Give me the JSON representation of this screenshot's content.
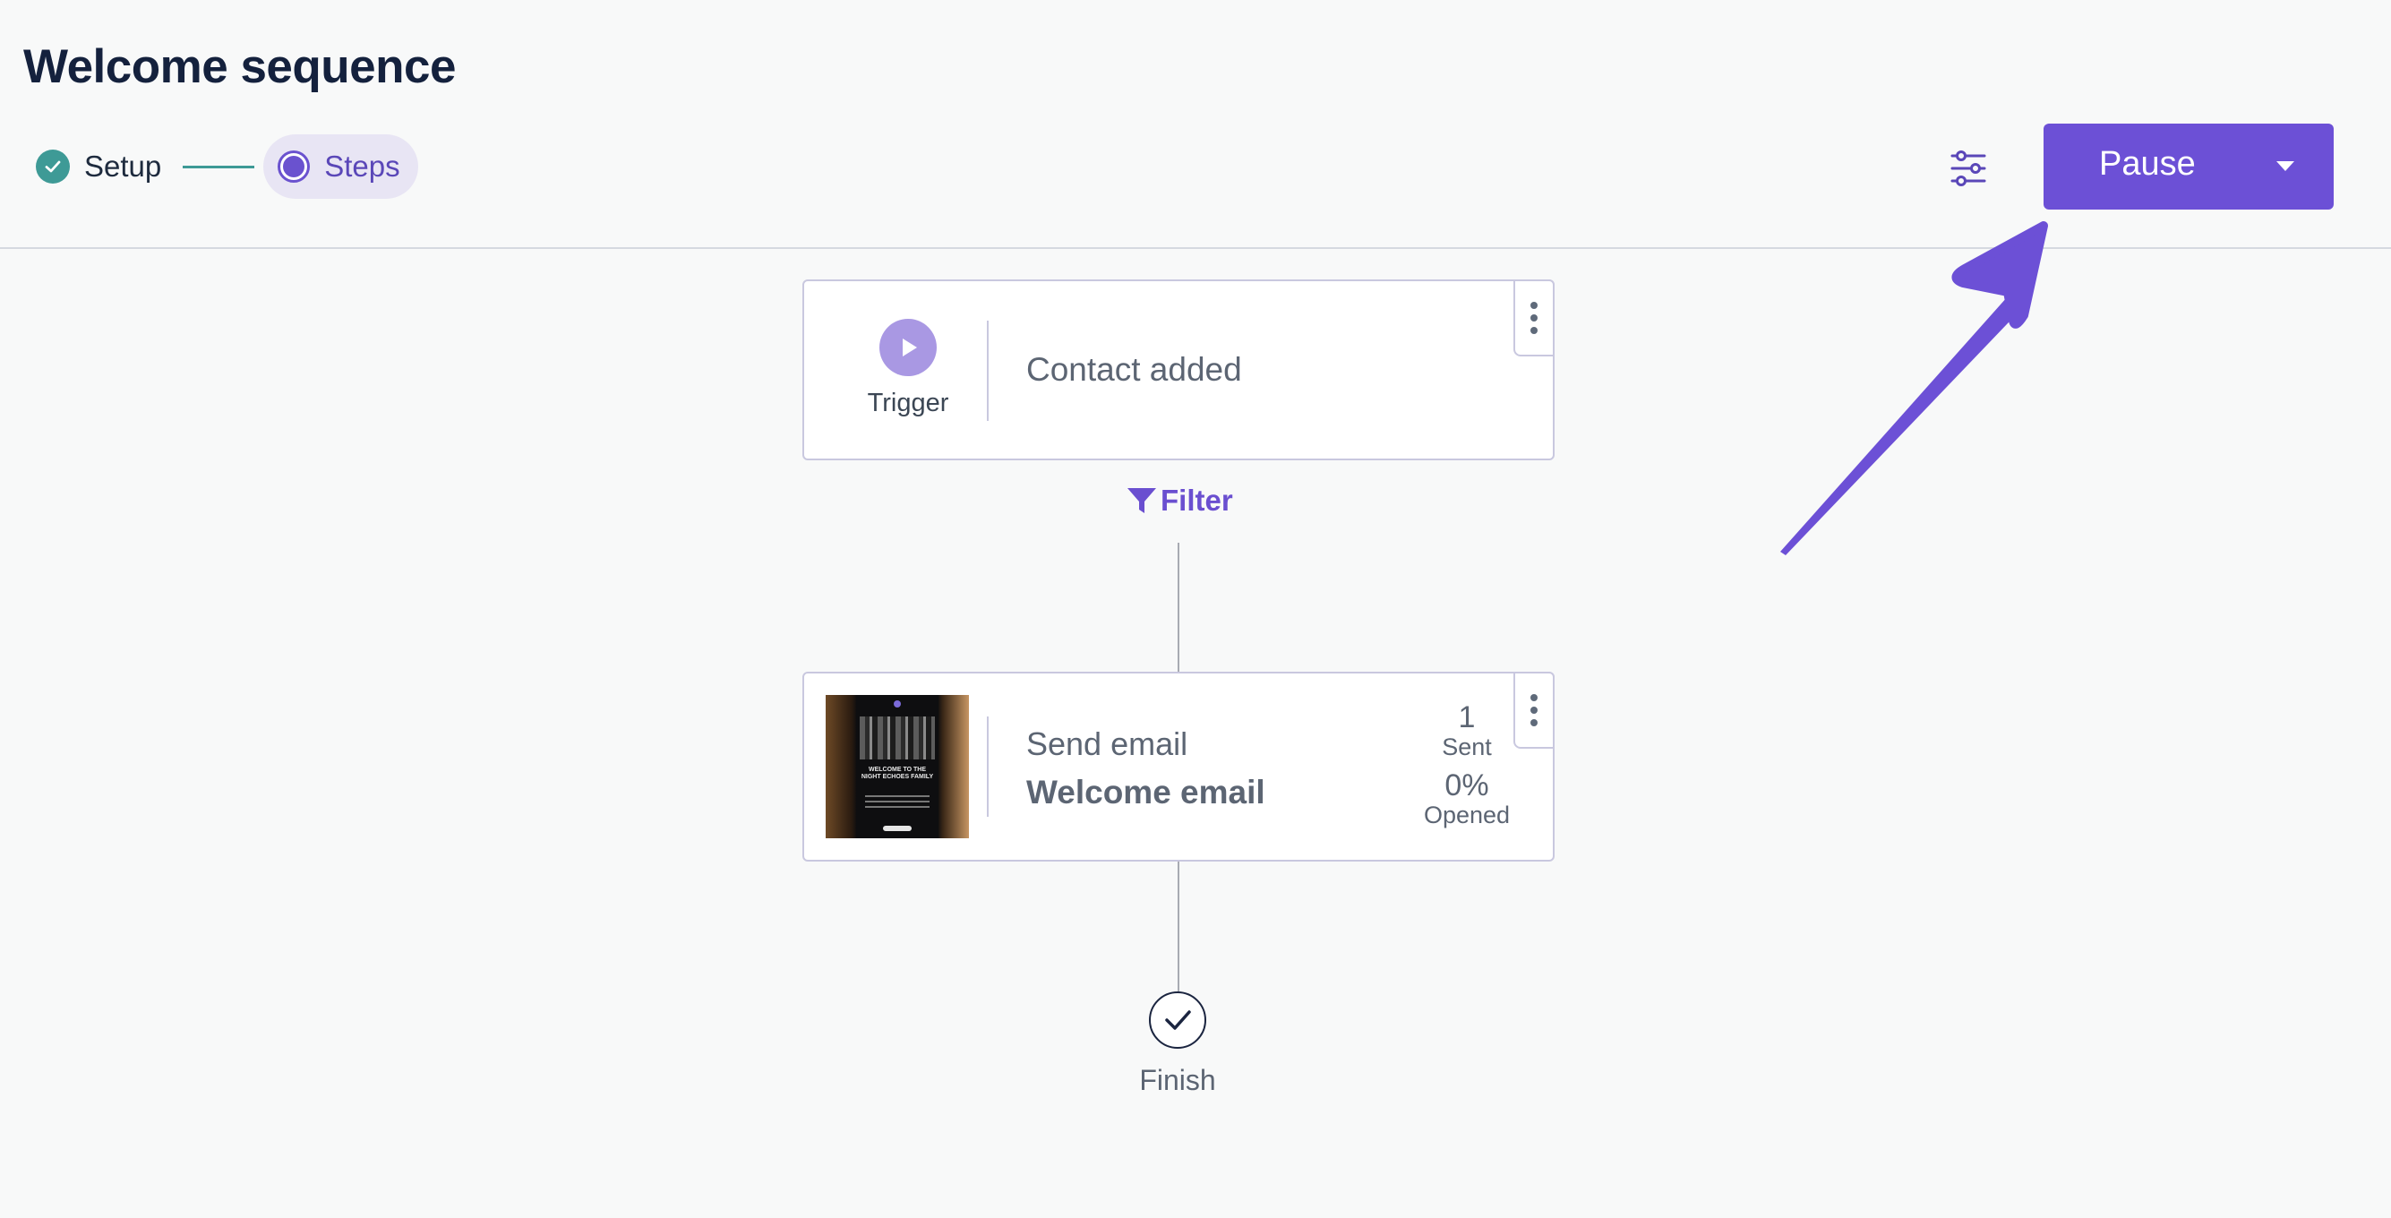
{
  "header": {
    "title": "Welcome sequence",
    "stepper": {
      "setup_label": "Setup",
      "steps_label": "Steps"
    },
    "actions": {
      "settings_icon": "sliders-icon",
      "pause_label": "Pause",
      "pause_dropdown_icon": "caret-down-icon"
    }
  },
  "flow": {
    "trigger": {
      "icon": "play-icon",
      "label": "Trigger",
      "title": "Contact added"
    },
    "filter": {
      "icon": "funnel-icon",
      "label": "Filter"
    },
    "email_step": {
      "type": "Send email",
      "name": "Welcome email",
      "thumbnail_text": "WELCOME TO THE NIGHT ECHOES FAMILY",
      "stats": {
        "sent_value": "1",
        "sent_label": "Sent",
        "opened_value": "0%",
        "opened_label": "Opened"
      }
    },
    "finish": {
      "icon": "check-icon",
      "label": "Finish"
    }
  },
  "colors": {
    "accent": "#6c50d6",
    "teal": "#3e9a96",
    "card_border": "#c9c8df",
    "text_muted": "#5c6573"
  }
}
